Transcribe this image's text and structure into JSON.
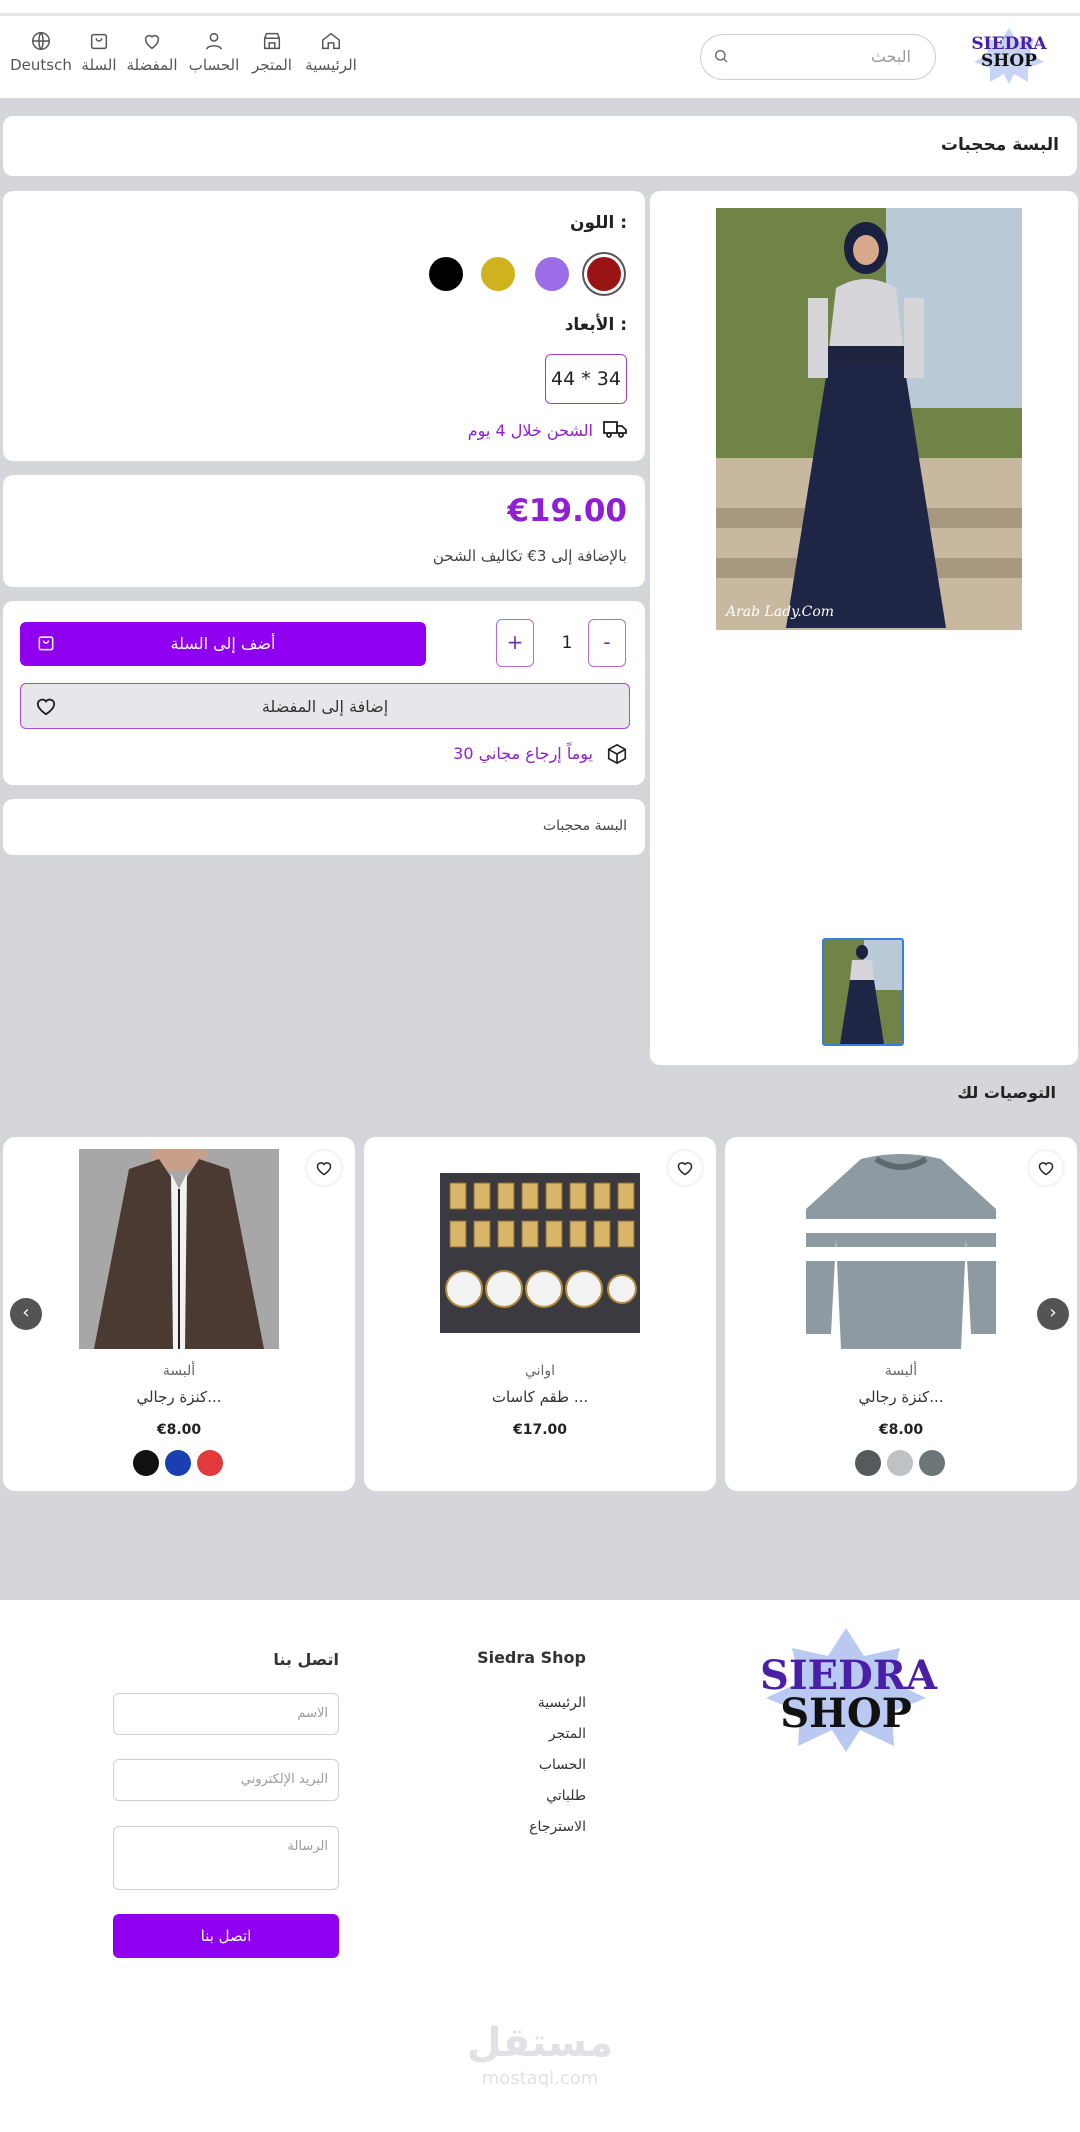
{
  "nav": {
    "items": [
      {
        "label": "Deutsch",
        "icon": "globe-icon"
      },
      {
        "label": "السلة",
        "icon": "bag-icon"
      },
      {
        "label": "المفضلة",
        "icon": "heart-icon"
      },
      {
        "label": "الحساب",
        "icon": "user-icon"
      },
      {
        "label": "المتجر",
        "icon": "store-icon"
      },
      {
        "label": "الرئيسية",
        "icon": "home-icon"
      }
    ],
    "search_placeholder": "البحث",
    "logo_line1": "SIEDRA",
    "logo_line2": "SHOP"
  },
  "breadcrumb_title": "البسة محجبات",
  "product": {
    "color_label": "اللون :",
    "colors": [
      "#9b1414",
      "#9b6ee8",
      "#d0b21f",
      "#000000"
    ],
    "dimensions_label": "الأبعاد :",
    "dimension_value": "44 * 34",
    "shipping_text": "الشحن خلال 4 يوم",
    "price": "€19.00",
    "price_note": "بالإضافة إلى 3€ تكاليف الشحن",
    "quantity": "1",
    "minus_label": "-",
    "plus_label": "+",
    "add_to_cart_label": "أضف إلى السلة",
    "add_to_wishlist_label": "إضافة إلى المفضلة",
    "return_text": "30 يوماً إرجاع مجاني",
    "description": "البسة محجبات",
    "image_watermark": "Arab Lady.Com"
  },
  "recommendations": {
    "title": "التوصيات لك",
    "items": [
      {
        "category": "ألبسة",
        "name": "كنزة رجالي...",
        "price": "€8.00",
        "colors": [
          "#555a5c",
          "#bfc2c4",
          "#6c7578"
        ]
      },
      {
        "category": "اواني",
        "name": "طقم كاسات ...",
        "price": "€17.00",
        "colors": []
      },
      {
        "category": "ألبسة",
        "name": "كنزة رجالي...",
        "price": "€8.00",
        "colors": [
          "#111111",
          "#1a3fb0",
          "#e03a3a"
        ]
      }
    ]
  },
  "footer": {
    "logo_line1": "SIEDRA",
    "logo_line2": "SHOP",
    "links_title": "Siedra Shop",
    "links": [
      "الرئيسية",
      "المتجر",
      "الحساب",
      "طلباتي",
      "الاسترجاع"
    ],
    "contact_title": "اتصل بنا",
    "name_placeholder": "الاسم",
    "email_placeholder": "البريد الإلكتروني",
    "message_placeholder": "الرسالة",
    "contact_button": "اتصل بنا",
    "watermark_ar": "مستقل",
    "watermark_en": "mostaql.com"
  },
  "accent_color": "#9000f0"
}
